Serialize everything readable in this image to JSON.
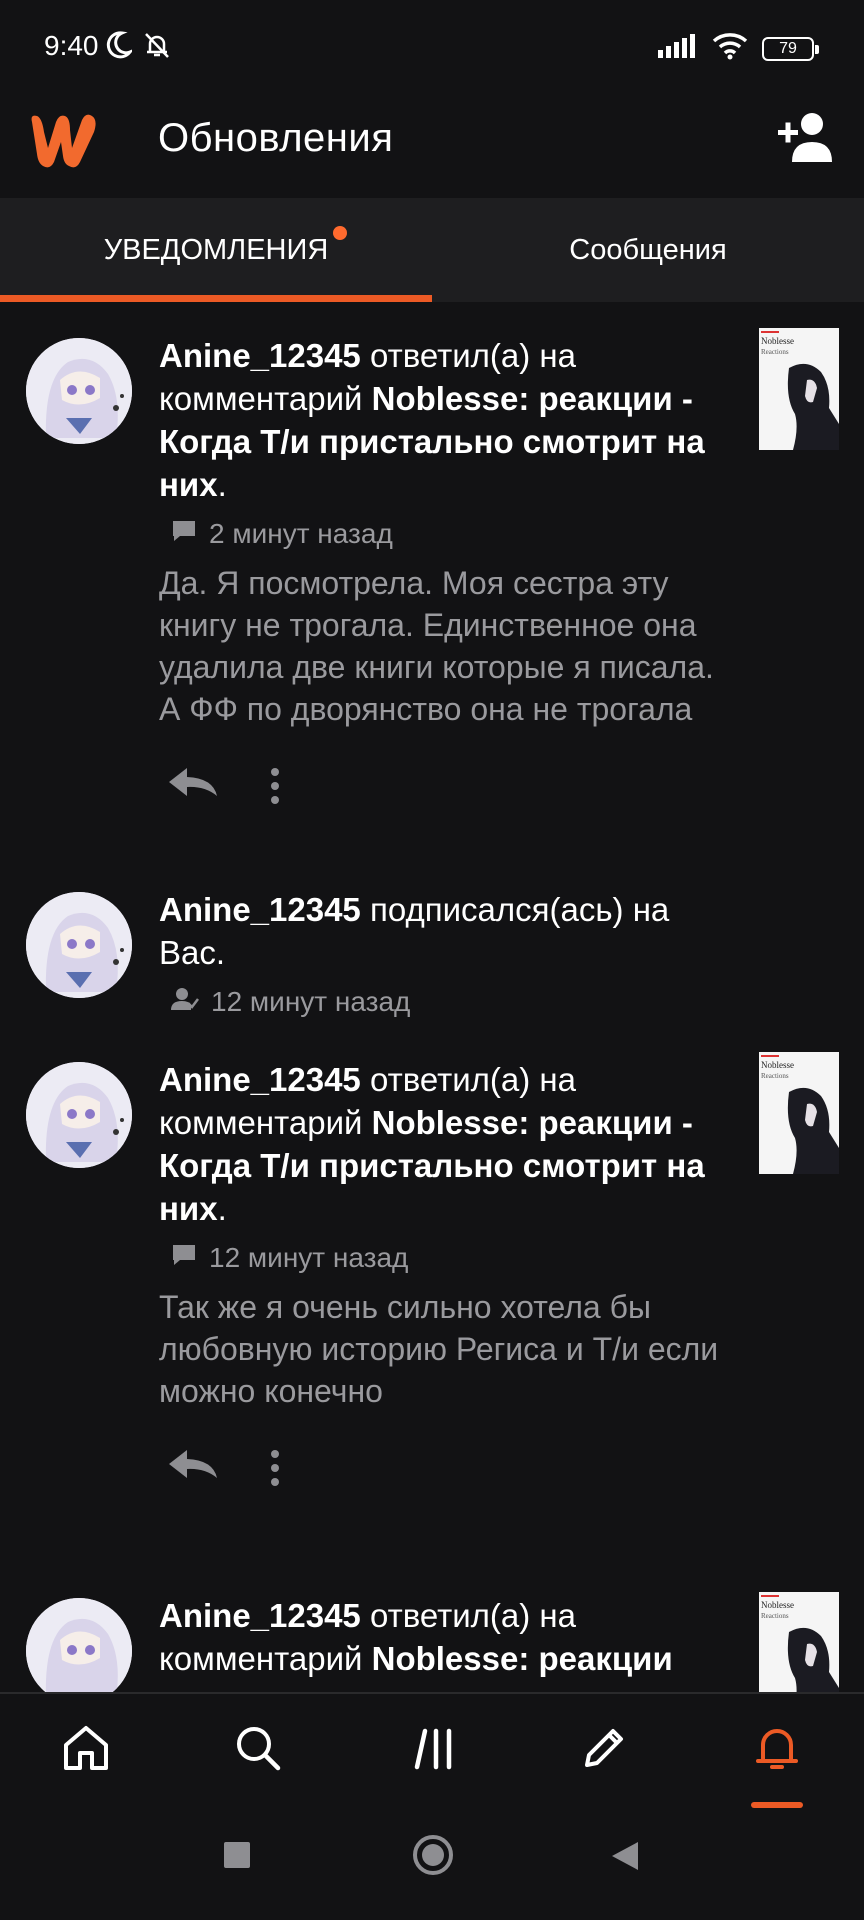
{
  "status_bar": {
    "time": "9:40",
    "battery": "79",
    "icons": [
      "moon-icon",
      "bell-off-icon",
      "signal-icon",
      "wifi-icon",
      "battery-icon"
    ]
  },
  "header": {
    "title": "Обновления",
    "logo": "wattpad-logo",
    "action_icon": "add-user-icon"
  },
  "tabs": [
    {
      "label": "УВЕДОМЛЕНИЯ",
      "active": true,
      "has_badge": true
    },
    {
      "label": "Сообщения",
      "active": false,
      "has_badge": false
    }
  ],
  "notifications": [
    {
      "user": "Anine_12345",
      "action": "ответил(а) на комментарий",
      "story": "Noblesse: реакции - Когда Т/и пристально смотрит на них",
      "end": ".",
      "meta_icon": "comment-icon",
      "time": "2 минут назад",
      "text": "Да. Я посмотрела. Моя сестра эту книгу не трогала. Единственное она удалила две книги которые я писала. А ФФ по дворянство она не трогала",
      "cover_title": "Noblesse",
      "cover_subtitle": "Reactions"
    },
    {
      "user": "Anine_12345",
      "action": "подписался(ась) на Вас.",
      "meta_icon": "follow-icon",
      "time": "12 минут назад"
    },
    {
      "user": "Anine_12345",
      "action": "ответил(а) на комментарий",
      "story": "Noblesse: реакции - Когда Т/и пристально смотрит на них",
      "end": ".",
      "meta_icon": "comment-icon",
      "time": "12 минут назад",
      "text": "Так же я очень сильно хотела бы любовную историю Региса и Т/и если можно конечно",
      "cover_title": "Noblesse",
      "cover_subtitle": "Reactions"
    },
    {
      "user": "Anine_12345",
      "action": "ответил(а) на комментарий",
      "story": "Noblesse: реакции",
      "cover_title": "Noblesse",
      "cover_subtitle": "Reactions"
    }
  ],
  "bottom_nav": [
    {
      "icon": "home-icon",
      "active": false
    },
    {
      "icon": "search-icon",
      "active": false
    },
    {
      "icon": "library-icon",
      "active": false
    },
    {
      "icon": "write-icon",
      "active": false
    },
    {
      "icon": "notifications-icon",
      "active": true
    }
  ],
  "colors": {
    "background": "#121214",
    "accent": "#ec5a25",
    "secondary_text": "#9a9a9e",
    "tab_bar": "#1e1e20"
  }
}
